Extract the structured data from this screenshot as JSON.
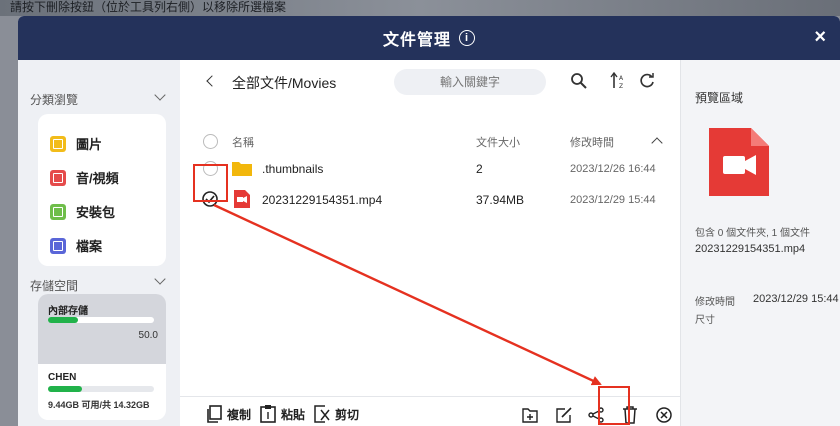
{
  "background": {
    "caption": "請按下刪除按鈕（位於工具列右側）以移除所選檔案"
  },
  "window": {
    "title": "文件管理",
    "close_glyph": "×",
    "info_glyph": "i"
  },
  "sidebar": {
    "browse_header": "分類瀏覽",
    "categories": [
      {
        "label": "圖片",
        "color": "#f2bc1a"
      },
      {
        "label": "音/視頻",
        "color": "#e54b4b"
      },
      {
        "label": "安裝包",
        "color": "#6fbe4a"
      },
      {
        "label": "檔案",
        "color": "#5a66d8"
      }
    ],
    "storage_header": "存儲空間",
    "storage": [
      {
        "name": "內部存儲",
        "value": "50.0",
        "fill_fraction": 0.28
      },
      {
        "name": "CHEN",
        "value": "9.44GB 可用/共 14.32GB",
        "fill_fraction": 0.32
      }
    ]
  },
  "main": {
    "path": "全部文件/Movies",
    "search_placeholder": "輸入關鍵字",
    "columns": {
      "name": "名稱",
      "size": "文件大小",
      "modified": "修改時間"
    },
    "rows": [
      {
        "name": ".thumbnails",
        "size": "2",
        "modified": "2023/12/26 16:44",
        "type": "folder",
        "selected": false
      },
      {
        "name": "20231229154351.mp4",
        "size": "37.94MB",
        "modified": "2023/12/29 15:44",
        "type": "video",
        "selected": true
      }
    ],
    "toolbar": {
      "copy": "複制",
      "paste": "粘貼",
      "cut": "剪切"
    }
  },
  "preview": {
    "header": "預覽區域",
    "contains": "包含 0 個文件夾, 1 個文件",
    "filename": "20231229154351.mp4",
    "modified_label": "修改時間",
    "modified_value": "2023/12/29 15:44",
    "size_label": "尺寸"
  },
  "colors": {
    "titlebar": "#24325b",
    "annotation": "#e53120",
    "accent_green": "#21b24a",
    "video_red": "#e53a36",
    "folder": "#f2b70c"
  }
}
